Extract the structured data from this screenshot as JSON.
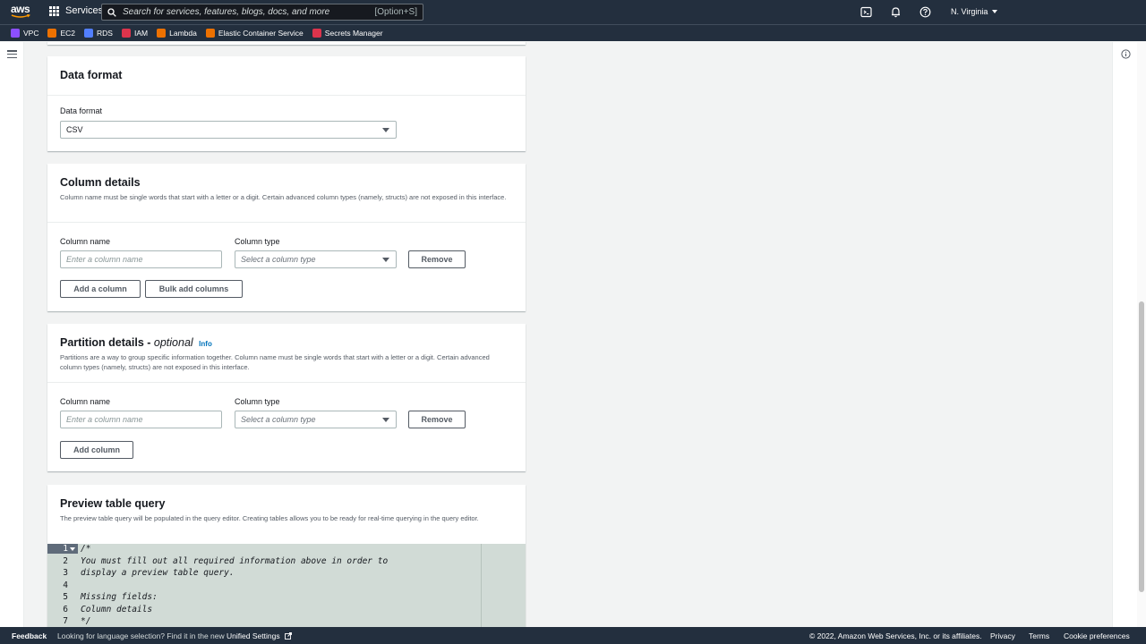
{
  "nav": {
    "logo": "aws",
    "services_label": "Services",
    "search_placeholder": "Search for services, features, blogs, docs, and more",
    "search_shortcut": "[Option+S]",
    "region": "N. Virginia"
  },
  "favorites": [
    {
      "label": "VPC",
      "color": "#8c4fff"
    },
    {
      "label": "EC2",
      "color": "#ed7100"
    },
    {
      "label": "RDS",
      "color": "#527fff"
    },
    {
      "label": "IAM",
      "color": "#dd344c"
    },
    {
      "label": "Lambda",
      "color": "#ed7100"
    },
    {
      "label": "Elastic Container Service",
      "color": "#ed7100"
    },
    {
      "label": "Secrets Manager",
      "color": "#dd344c"
    }
  ],
  "data_format": {
    "title": "Data format",
    "field_label": "Data format",
    "value": "CSV"
  },
  "column_details": {
    "title": "Column details",
    "description": "Column name must be single words that start with a letter or a digit. Certain advanced column types (namely, structs) are not exposed in this interface.",
    "name_label": "Column name",
    "name_placeholder": "Enter a column name",
    "type_label": "Column type",
    "type_placeholder": "Select a column type",
    "remove_label": "Remove",
    "add_label": "Add a column",
    "bulk_label": "Bulk add columns"
  },
  "partition_details": {
    "title": "Partition details - ",
    "title_optional": "optional",
    "info_label": "Info",
    "description": "Partitions are a way to group specific information together. Column name must be single words that start with a letter or a digit. Certain advanced column types (namely, structs) are not exposed in this interface.",
    "name_label": "Column name",
    "name_placeholder": "Enter a column name",
    "type_label": "Column type",
    "type_placeholder": "Select a column type",
    "remove_label": "Remove",
    "add_label": "Add column"
  },
  "preview": {
    "title": "Preview table query",
    "description": "The preview table query will be populated in the query editor. Creating tables allows you to be ready for real-time querying in the query editor.",
    "lines": [
      {
        "n": "1",
        "text": "/*"
      },
      {
        "n": "2",
        "text": "You must fill out all required information above in order to"
      },
      {
        "n": "3",
        "text": "display a preview table query."
      },
      {
        "n": "4",
        "text": ""
      },
      {
        "n": "5",
        "text": "Missing fields:"
      },
      {
        "n": "6",
        "text": "Column details"
      },
      {
        "n": "7",
        "text": "*/"
      }
    ]
  },
  "footer": {
    "feedback": "Feedback",
    "language_prefix": "Looking for language selection? Find it in the new",
    "unified_settings": "Unified Settings",
    "copyright": "© 2022, Amazon Web Services, Inc. or its affiliates.",
    "privacy": "Privacy",
    "terms": "Terms",
    "cookies": "Cookie preferences"
  }
}
